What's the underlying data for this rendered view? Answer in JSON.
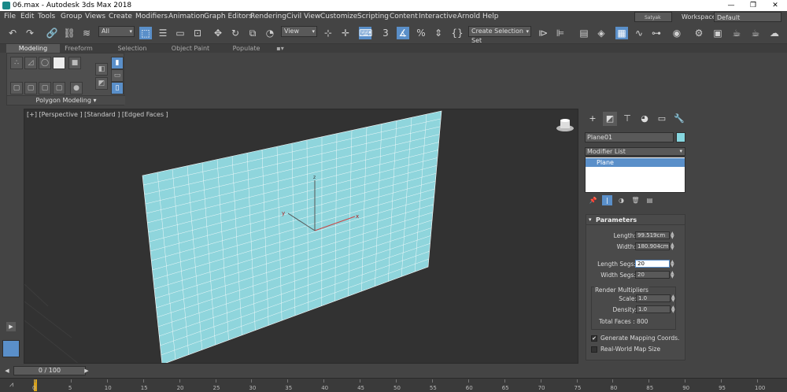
{
  "window": {
    "title": "06.max - Autodesk 3ds Max 2018",
    "min": "—",
    "max": "❐",
    "close": "✕"
  },
  "menu": {
    "items": [
      "File",
      "Edit",
      "Tools",
      "Group",
      "Views",
      "Create",
      "Modifiers",
      "Animation",
      "Graph Editors",
      "Rendering",
      "Civil View",
      "Customize",
      "Scripting",
      "Content",
      "Interactive",
      "Arnold",
      "Help"
    ],
    "user": "Satyak Joshi",
    "workspaces_label": "Workspaces:",
    "workspace_value": "Default"
  },
  "toolbar": {
    "filter_value": "All",
    "refcoord_value": "View",
    "selection_set_value": "Create Selection Set",
    "percent_icon": "%",
    "snap_label": "3"
  },
  "ribbon": {
    "tabs": [
      "Modeling",
      "Freeform",
      "Selection",
      "Object Paint",
      "Populate"
    ],
    "selected_tab": "Modeling",
    "panel_label": "Polygon Modeling"
  },
  "viewport": {
    "label": "[+] [Perspective ] [Standard ] [Edged Faces ]",
    "axis_x": "x",
    "axis_y": "y",
    "axis_z": "z",
    "mesh_color": "#8fd5dc",
    "wire_color": "#ffffff"
  },
  "command_panel": {
    "object_name": "Plane01",
    "object_color": "#86d7e0",
    "modifier_list": "Modifier List",
    "stack_items": [
      "Plane"
    ],
    "parameters": {
      "header": "Parameters",
      "length_label": "Length:",
      "length_value": "99.519cm",
      "width_label": "Width:",
      "width_value": "180.904cm",
      "length_segs_label": "Length Segs:",
      "length_segs_value": "20",
      "width_segs_label": "Width Segs:",
      "width_segs_value": "20",
      "render_multipliers": "Render Multipliers",
      "scale_label": "Scale:",
      "scale_value": "1.0",
      "density_label": "Density:",
      "density_value": "1.0",
      "total_faces": "Total Faces : 800",
      "gen_mapping": "Generate Mapping Coords.",
      "gen_mapping_checked": true,
      "real_world": "Real-World Map Size",
      "real_world_checked": false
    }
  },
  "timeline": {
    "frame_display": "0 / 100",
    "ticks": [
      "0",
      "5",
      "10",
      "15",
      "20",
      "25",
      "30",
      "35",
      "40",
      "45",
      "50",
      "55",
      "60",
      "65",
      "70",
      "75",
      "80",
      "85",
      "90",
      "95",
      "100"
    ]
  }
}
